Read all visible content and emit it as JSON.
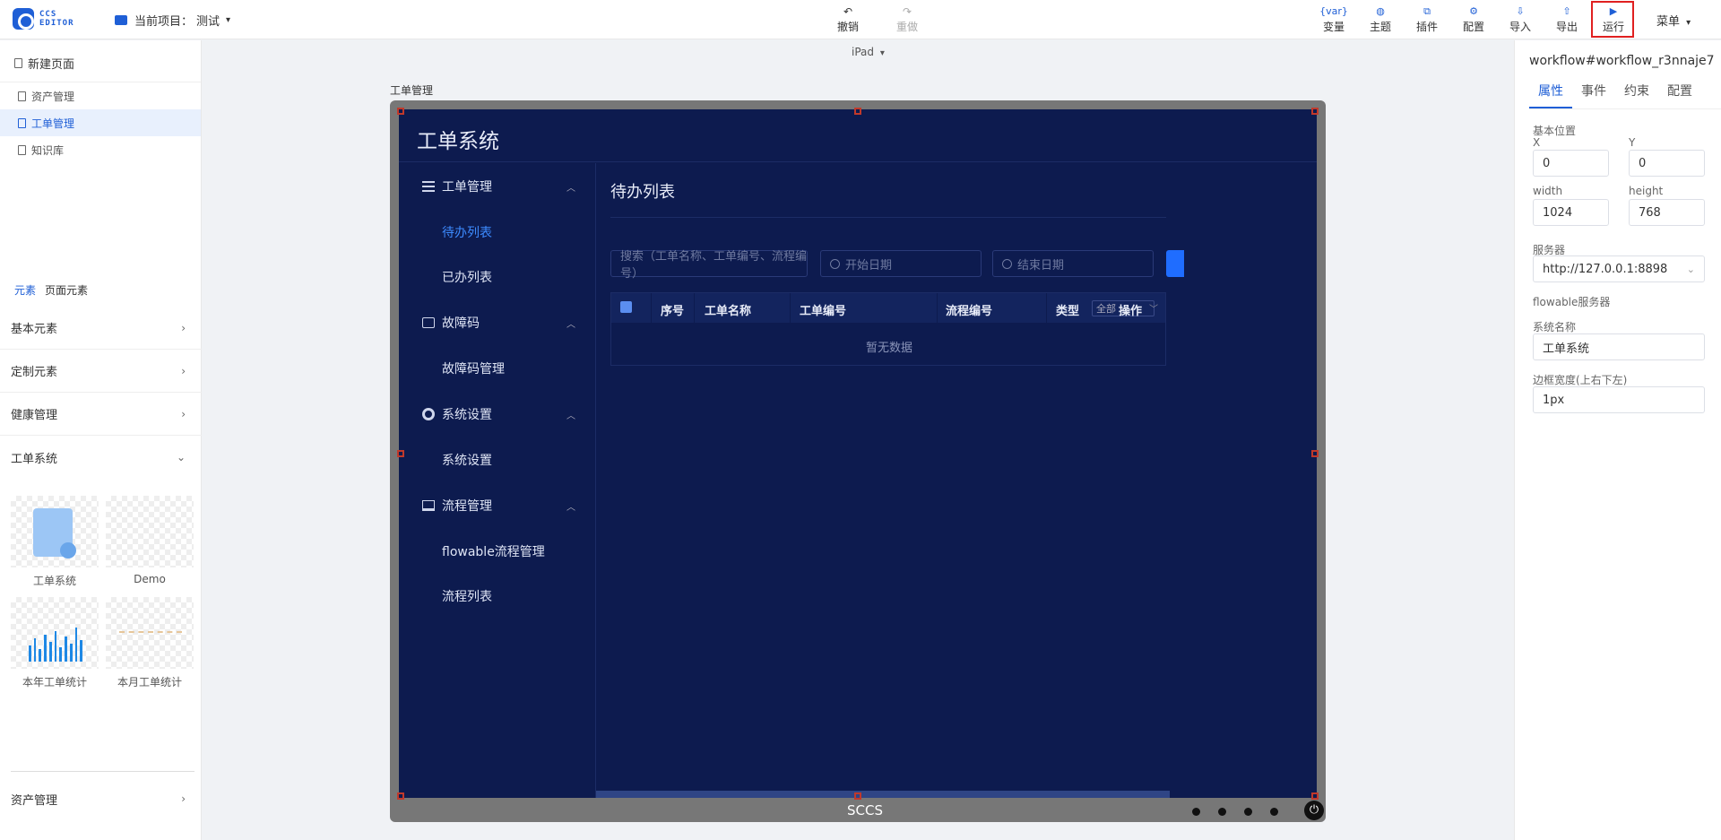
{
  "topbar": {
    "logo_line1": "CCS",
    "logo_line2": "EDITOR",
    "project_label": "当前项目：",
    "project_name": "测试",
    "undo": "撤销",
    "redo": "重做",
    "tools": [
      {
        "label": "变量",
        "icon": "{var}"
      },
      {
        "label": "主题",
        "icon": "◍"
      },
      {
        "label": "插件",
        "icon": "⧉"
      },
      {
        "label": "配置",
        "icon": "⚙"
      },
      {
        "label": "导入",
        "icon": "⇩"
      },
      {
        "label": "导出",
        "icon": "⇧"
      },
      {
        "label": "运行",
        "icon": "▶"
      }
    ],
    "menu": "菜单"
  },
  "left_panel": {
    "new_page": "新建页面",
    "pages": [
      "资产管理",
      "工单管理",
      "知识库"
    ],
    "active_page_index": 1,
    "tabs": [
      "元素",
      "页面元素"
    ],
    "categories": [
      "基本元素",
      "定制元素",
      "健康管理",
      "工单系统"
    ],
    "components": [
      "工单系统",
      "Demo",
      "本年工单统计",
      "本月工单统计"
    ],
    "asset_category": "资产管理"
  },
  "canvas": {
    "device": "iPad",
    "frame_label": "工单管理",
    "device_label": "SCCS"
  },
  "app": {
    "title": "工单系统",
    "menu": [
      {
        "label": "工单管理",
        "icon": "list-icon",
        "children": [
          "待办列表",
          "已办列表"
        ]
      },
      {
        "label": "故障码",
        "icon": "inbox-icon",
        "children": [
          "故障码管理"
        ]
      },
      {
        "label": "系统设置",
        "icon": "gear-icon",
        "children": [
          "系统设置"
        ]
      },
      {
        "label": "流程管理",
        "icon": "board-icon",
        "children": [
          "flowable流程管理",
          "流程列表"
        ]
      }
    ],
    "active_submenu": "待办列表",
    "main_title": "待办列表",
    "search_placeholder": "搜索（工单名称、工单编号、流程编号）",
    "start_date": "开始日期",
    "end_date": "结束日期",
    "columns": [
      "序号",
      "工单名称",
      "工单编号",
      "流程编号",
      "类型",
      "操作"
    ],
    "type_filter": "全部",
    "empty_text": "暂无数据"
  },
  "right_panel": {
    "title": "workflow#workflow_r3nnaje7",
    "tabs": [
      "属性",
      "事件",
      "约束",
      "配置"
    ],
    "position_label": "基本位置",
    "x_label": "X",
    "x_value": "0",
    "y_label": "Y",
    "y_value": "0",
    "width_label": "width",
    "width_value": "1024",
    "height_label": "height",
    "height_value": "768",
    "server_label": "服务器",
    "server_value": "http://127.0.0.1:8898",
    "server_hint": "flowable服务器",
    "system_name_label": "系统名称",
    "system_name_value": "工单系统",
    "border_label": "边框宽度(上右下左)",
    "border_value": "1px"
  }
}
